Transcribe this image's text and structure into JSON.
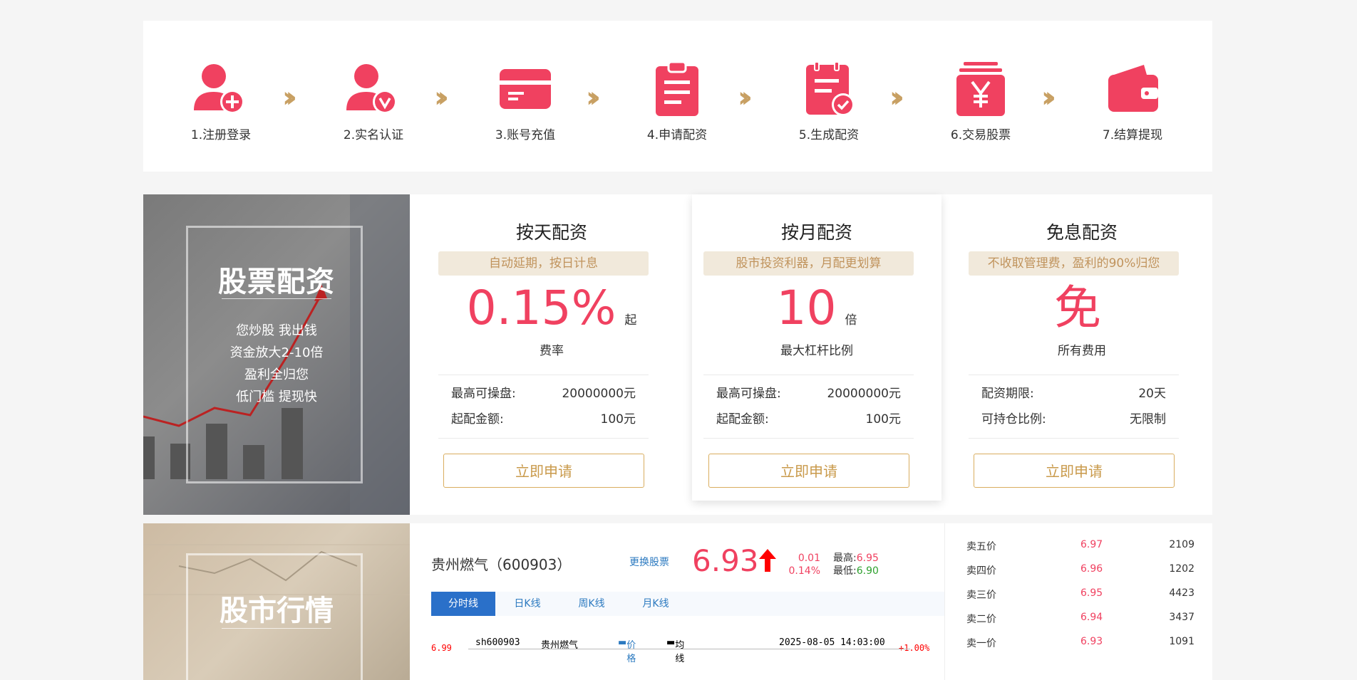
{
  "steps": [
    "1.注册登录",
    "2.实名认证",
    "3.账号充值",
    "4.申请配资",
    "5.生成配资",
    "6.交易股票",
    "7.结算提现"
  ],
  "step_icons": [
    "user-add-icon",
    "user-verified-icon",
    "card-icon",
    "clipboard-icon",
    "document-check-icon",
    "yen-wallet-icon",
    "wallet-icon"
  ],
  "colors": {
    "accent": "#f04160",
    "gold": "#c8a063",
    "blue": "#2a70c9"
  },
  "promo": {
    "title": "股票配资",
    "lines": [
      "您炒股 我出钱",
      "资金放大2-10倍",
      "盈利全归您",
      "低门槛 提现快"
    ]
  },
  "plans": [
    {
      "title": "按天配资",
      "tag": "自动延期，按日计息",
      "value": "0.15%",
      "unit": "起",
      "sub": "费率",
      "rows": [
        {
          "k": "最高可操盘:",
          "v": "20000000元"
        },
        {
          "k": "起配金额:",
          "v": "100元"
        }
      ],
      "button": "立即申请"
    },
    {
      "title": "按月配资",
      "tag": "股市投资利器，月配更划算",
      "value": "10",
      "unit": "倍",
      "sub": "最大杠杆比例",
      "rows": [
        {
          "k": "最高可操盘:",
          "v": "20000000元"
        },
        {
          "k": "起配金额:",
          "v": "100元"
        }
      ],
      "button": "立即申请"
    },
    {
      "title": "免息配资",
      "tag": "不收取管理费，盈利的90%归您",
      "value": "免",
      "unit": "",
      "sub": "所有费用",
      "rows": [
        {
          "k": "配资期限:",
          "v": "20天"
        },
        {
          "k": "可持仓比例:",
          "v": "无限制"
        }
      ],
      "button": "立即申请"
    }
  ],
  "market": {
    "promo_title": "股市行情",
    "stock_name": "贵州燃气（600903）",
    "change_link": "更换股票",
    "price": "6.93",
    "delta": "0.01",
    "delta_pct": "0.14%",
    "high_label": "最高:",
    "high": "6.95",
    "low_label": "最低:",
    "low": "6.90",
    "tabs": [
      "分时线",
      "日K线",
      "周K线",
      "月K线"
    ],
    "chart_header": {
      "code": "sh600903",
      "name": "贵州燃气",
      "price_legend": "价格",
      "avg_legend": "均线",
      "datetime": "2025-08-05 14:03:00",
      "top_pct": "+1.00%",
      "top_price": "6.99"
    },
    "orderbook": [
      {
        "label": "卖五价",
        "price": "6.97",
        "vol": "2109"
      },
      {
        "label": "卖四价",
        "price": "6.96",
        "vol": "1202"
      },
      {
        "label": "卖三价",
        "price": "6.95",
        "vol": "4423"
      },
      {
        "label": "卖二价",
        "price": "6.94",
        "vol": "3437"
      },
      {
        "label": "卖一价",
        "price": "6.93",
        "vol": "1091"
      }
    ]
  }
}
